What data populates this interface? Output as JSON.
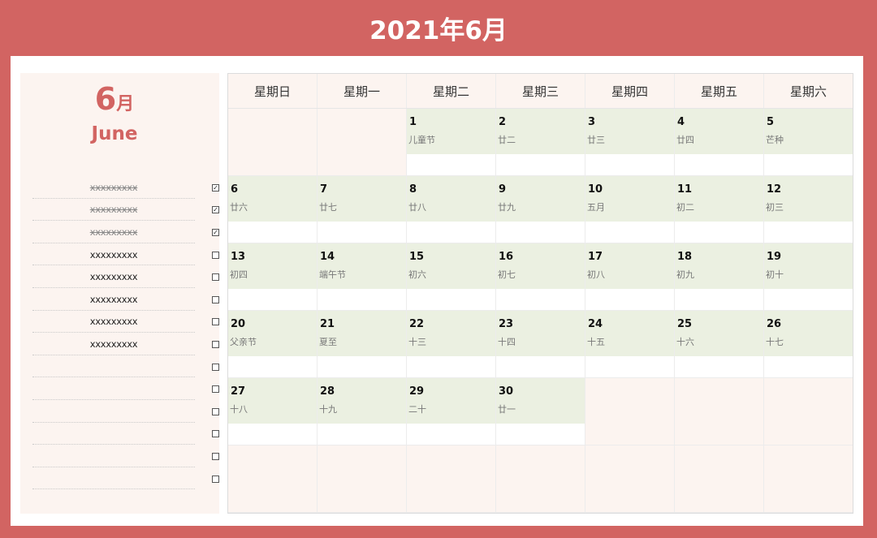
{
  "title": "2021年6月",
  "sidebar": {
    "month_number": "6",
    "month_suffix": "月",
    "month_english": "June",
    "todos": [
      {
        "text": "xxxxxxxxx",
        "done": true
      },
      {
        "text": "xxxxxxxxx",
        "done": true
      },
      {
        "text": "xxxxxxxxx",
        "done": true
      },
      {
        "text": "xxxxxxxxx",
        "done": false
      },
      {
        "text": "xxxxxxxxx",
        "done": false
      },
      {
        "text": "xxxxxxxxx",
        "done": false
      },
      {
        "text": "xxxxxxxxx",
        "done": false
      },
      {
        "text": "xxxxxxxxx",
        "done": false
      },
      {
        "text": "",
        "done": false
      },
      {
        "text": "",
        "done": false
      },
      {
        "text": "",
        "done": false
      },
      {
        "text": "",
        "done": false
      },
      {
        "text": "",
        "done": false
      },
      {
        "text": "",
        "done": false
      }
    ]
  },
  "calendar": {
    "weekdays": [
      "星期日",
      "星期一",
      "星期二",
      "星期三",
      "星期四",
      "星期五",
      "星期六"
    ],
    "weeks": [
      [
        null,
        null,
        {
          "day": "1",
          "lunar": "儿童节"
        },
        {
          "day": "2",
          "lunar": "廿二"
        },
        {
          "day": "3",
          "lunar": "廿三"
        },
        {
          "day": "4",
          "lunar": "廿四"
        },
        {
          "day": "5",
          "lunar": "芒种"
        }
      ],
      [
        {
          "day": "6",
          "lunar": "廿六"
        },
        {
          "day": "7",
          "lunar": "廿七"
        },
        {
          "day": "8",
          "lunar": "廿八"
        },
        {
          "day": "9",
          "lunar": "廿九"
        },
        {
          "day": "10",
          "lunar": "五月"
        },
        {
          "day": "11",
          "lunar": "初二"
        },
        {
          "day": "12",
          "lunar": "初三"
        }
      ],
      [
        {
          "day": "13",
          "lunar": "初四"
        },
        {
          "day": "14",
          "lunar": "端午节"
        },
        {
          "day": "15",
          "lunar": "初六"
        },
        {
          "day": "16",
          "lunar": "初七"
        },
        {
          "day": "17",
          "lunar": "初八"
        },
        {
          "day": "18",
          "lunar": "初九"
        },
        {
          "day": "19",
          "lunar": "初十"
        }
      ],
      [
        {
          "day": "20",
          "lunar": "父亲节"
        },
        {
          "day": "21",
          "lunar": "夏至"
        },
        {
          "day": "22",
          "lunar": "十三"
        },
        {
          "day": "23",
          "lunar": "十四"
        },
        {
          "day": "24",
          "lunar": "十五"
        },
        {
          "day": "25",
          "lunar": "十六"
        },
        {
          "day": "26",
          "lunar": "十七"
        }
      ],
      [
        {
          "day": "27",
          "lunar": "十八"
        },
        {
          "day": "28",
          "lunar": "十九"
        },
        {
          "day": "29",
          "lunar": "二十"
        },
        {
          "day": "30",
          "lunar": "廿一"
        },
        null,
        null,
        null
      ],
      [
        null,
        null,
        null,
        null,
        null,
        null,
        null
      ]
    ]
  },
  "colors": {
    "frame": "#d26462",
    "accent_text": "#d26462",
    "sidebar_bg": "#fcf4f0",
    "day_fill": "#ebf0e1"
  }
}
